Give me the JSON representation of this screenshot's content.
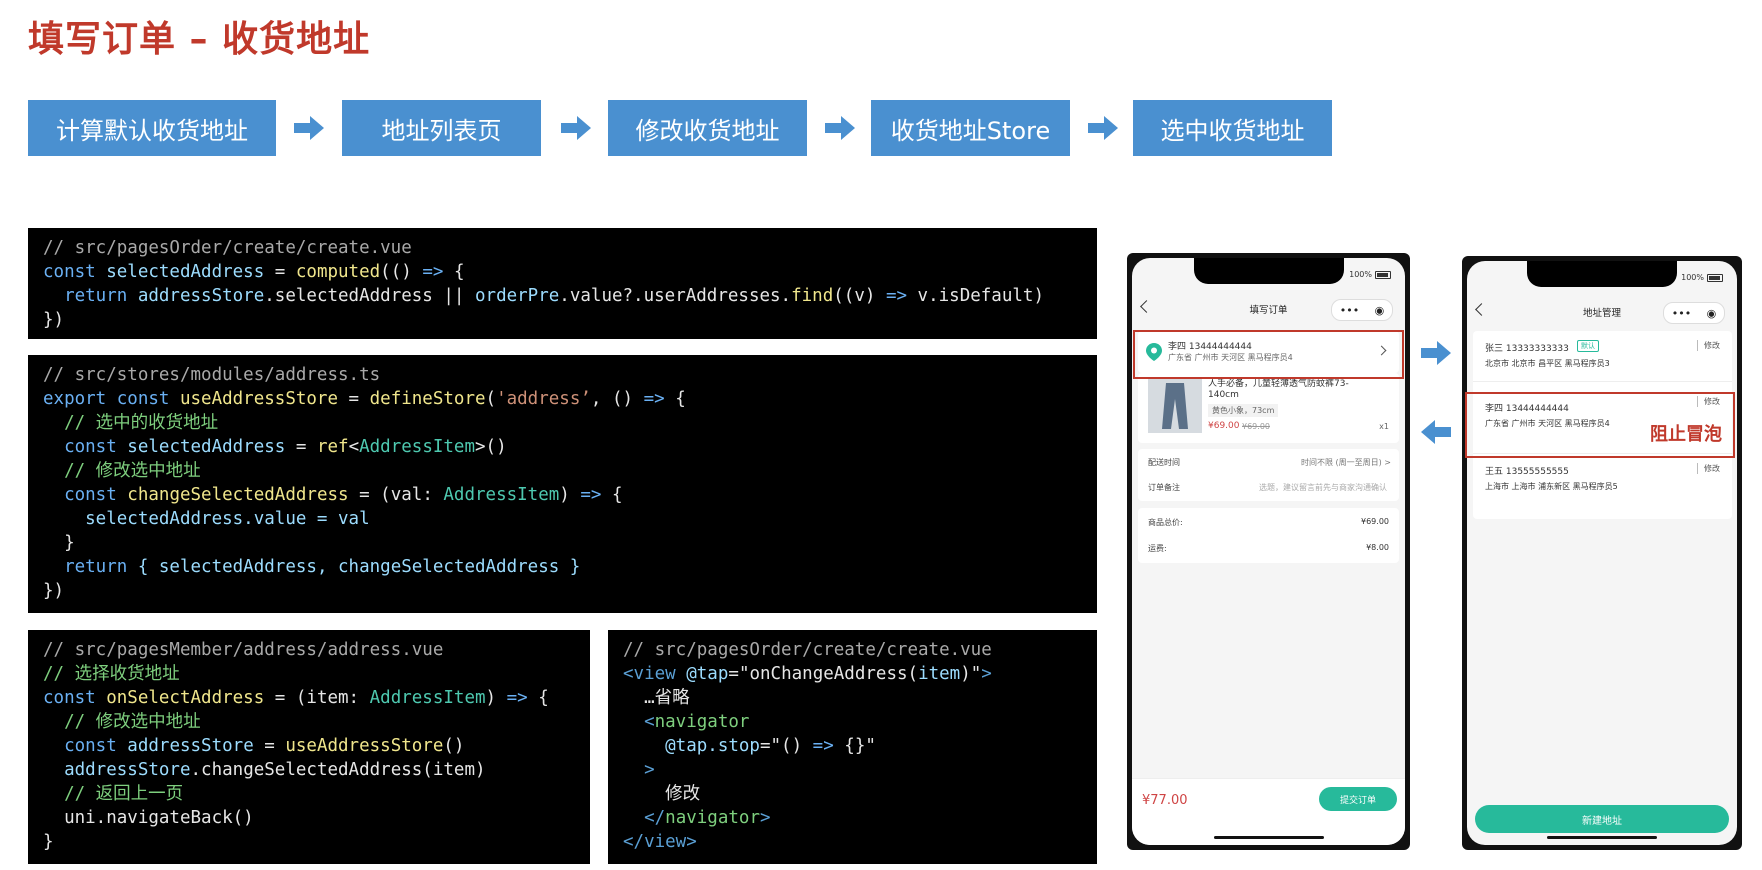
{
  "title": "填写订单 – 收货地址",
  "steps": [
    "计算默认收货地址",
    "地址列表页",
    "修改收货地址",
    "收货地址Store",
    "选中收货地址"
  ],
  "colors": {
    "accent_blue": "#4a90d0",
    "title_red": "#c0392b",
    "green": "#27ba9b",
    "price_red": "#cf4444"
  },
  "code1": {
    "comment": "// src/pagesOrder/create/create.vue",
    "l2_const": "const ",
    "l2_var": "selectedAddress",
    "l2_eq": " = ",
    "l2_fn": "computed",
    "l2_open": "(() ",
    "l2_arrow": "=>",
    "l2_brace": " {",
    "l3_ret": "  return ",
    "l3_store": "addressStore",
    "l3_prop": ".selectedAddress",
    "l3_or": " || ",
    "l3_order": "orderPre",
    "l3_rest": ".value?.userAddresses.",
    "l3_find": "find",
    "l3_args": "((v) ",
    "l3_arrow": "=>",
    "l3_end": " v.isDefault)",
    "l4": "})"
  },
  "code2": {
    "comment": "// src/stores/modules/address.ts",
    "l2_export": "export const ",
    "l2_fn": "useAddressStore",
    "l2_eq": " = ",
    "l2_def": "defineStore",
    "l2_open": "(",
    "l2_str": "'address’",
    "l2_rest": ", () ",
    "l2_arrow": "=>",
    "l2_brace": " {",
    "l3_zh": "  // 选中的收货地址",
    "l4_const": "  const ",
    "l4_var": "selectedAddress",
    "l4_eq": " = ",
    "l4_ref": "ref",
    "l4_lt": "<",
    "l4_type": "AddressItem",
    "l4_gt": ">()",
    "l5_zh": "  // 修改选中地址",
    "l6_const": "  const ",
    "l6_fn": "changeSelectedAddress",
    "l6_eq": " = (val: ",
    "l6_type": "AddressItem",
    "l6_close": ") ",
    "l6_arrow": "=>",
    "l6_brace": " {",
    "l7": "    selectedAddress.value = val",
    "l8": "  }",
    "l9_ret": "  return ",
    "l9_rest": "{ selectedAddress, changeSelectedAddress }",
    "l10": "})"
  },
  "code3": {
    "comment": "// src/pagesMember/address/address.vue",
    "l2_zh": "// 选择收货地址",
    "l3_const": "const ",
    "l3_fn": "onSelectAddress",
    "l3_eq": " = (item: ",
    "l3_type": "AddressItem",
    "l3_close": ") ",
    "l3_arrow": "=>",
    "l3_brace": " {",
    "l4_zh": "  // 修改选中地址",
    "l5_const": "  const ",
    "l5_var": "addressStore",
    "l5_eq": " = ",
    "l5_fn": "useAddressStore",
    "l5_end": "()",
    "l6_var": "  addressStore",
    "l6_rest": ".changeSelectedAddress(item)",
    "l7_zh": "  // 返回上一页",
    "l8": "  uni.navigateBack()",
    "l9": "}"
  },
  "code4": {
    "comment": "// src/pagesOrder/create/create.vue",
    "l2_lt": "<",
    "l2_tag": "view",
    "l2_attr": " @tap",
    "l2_eq": "=",
    "l2_q1": "\"onChangeAddress(",
    "l2_item": "item",
    "l2_q2": ")\"",
    "l2_gt": ">",
    "l3": "  …省略",
    "l4_lt": "  <",
    "l4_tag": "navigator",
    "l5_attr": "    @tap.stop",
    "l5_eq": "=",
    "l5_val": "\"() ",
    "l5_arrow": "=>",
    "l5_end": " {}\"",
    "l6": "  >",
    "l7": "    修改",
    "l8_lt": "  </",
    "l8_tag": "navigator",
    "l8_gt": ">",
    "l9_lt": "</",
    "l9_tag": "view",
    "l9_gt": ">"
  },
  "phone1": {
    "battery": "100%",
    "nav_title": "填写订单",
    "capsule_more": "•••",
    "address_name": "李四 13444444444",
    "address_detail": "广东省 广州市 天河区 黑马程序员4",
    "product_name": "人手必备，儿童轻薄透气防蚊裤73-140cm",
    "product_spec": "黄色小象，73cm",
    "product_price": "¥69.00",
    "product_old_price": "¥69.00",
    "product_qty": "x1",
    "delivery_label": "配送时间",
    "delivery_value": "时间不限 (周一至周日) >",
    "remark_label": "订单备注",
    "remark_value": "选题，建议留言前先与商家沟通确认",
    "total_label": "商品总价:",
    "total_value": "¥69.00",
    "freight_label": "运费:",
    "freight_value": "¥8.00",
    "pay_total": "¥77.00",
    "submit_label": "提交订单"
  },
  "phone2": {
    "battery": "100%",
    "nav_title": "地址管理",
    "capsule_more": "•••",
    "addresses": [
      {
        "name": "张三 13333333333",
        "badge": "默认",
        "detail": "北京市 北京市 昌平区 黑马程序员3",
        "edit": "修改"
      },
      {
        "name": "李四 13444444444",
        "badge": "",
        "detail": "广东省 广州市 天河区 黑马程序员4",
        "edit": "修改"
      },
      {
        "name": "王五 13555555555",
        "badge": "",
        "detail": "上海市 上海市 浦东新区 黑马程序员5",
        "edit": "修改"
      }
    ],
    "stop_bubble": "阻止冒泡",
    "new_address": "新建地址"
  }
}
